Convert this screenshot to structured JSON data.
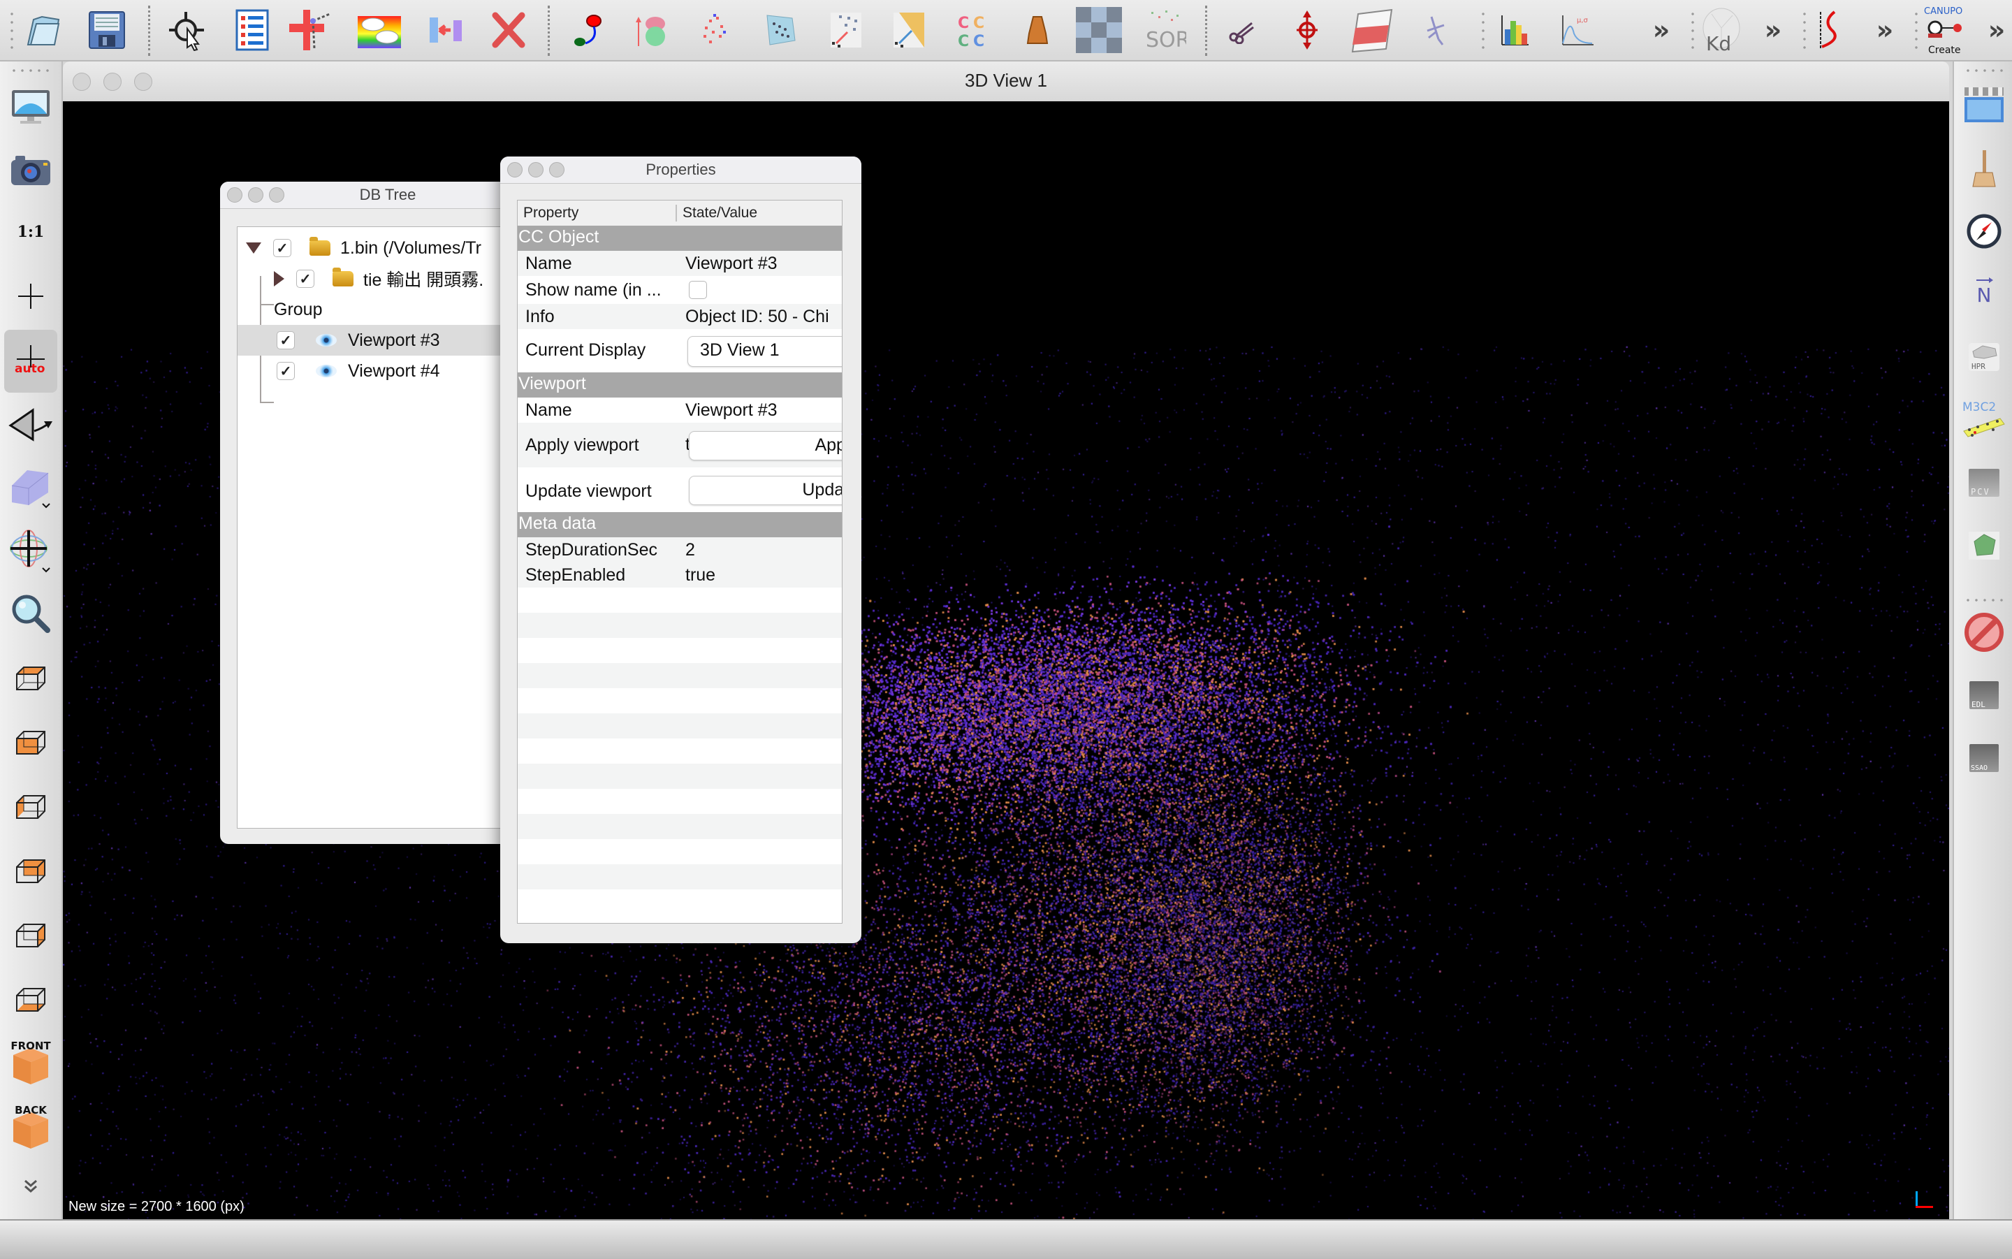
{
  "app": {
    "top_toolbar": {
      "groups": [
        [
          "open-icon",
          "save-icon"
        ],
        [
          "point-picking-icon",
          "properties-list-icon",
          "add-point-icon",
          "scalar-field-rainbow-icon",
          "merge-icon",
          "delete-icon"
        ],
        [
          "segment-icon",
          "normals-icon",
          "sample-points-icon",
          "mesh-icon",
          "registration-icon",
          "fine-registration-icon",
          "compare-cc-icon",
          "volume-icon",
          "checkerboard-icon",
          "sor-filter-icon"
        ],
        [
          "scissors-icon",
          "translate-rotate-icon",
          "cross-section-icon",
          "pick-rotation-center-icon"
        ],
        [
          "histogram-icon",
          "gaussian-fit-icon"
        ],
        [
          "kd-tree-icon"
        ],
        [
          "curve-icon"
        ],
        [
          "canupo-create-icon"
        ]
      ],
      "labels": {
        "sor": "SOR",
        "kd": "Kd",
        "canupo_top": "CANUPO",
        "canupo_bottom": "Create",
        "cc_compare": "CC"
      },
      "overflow_chevron": "»"
    },
    "left_toolbar": {
      "items": [
        {
          "icon": "fullscreen-display-icon"
        },
        {
          "icon": "camera-icon"
        },
        {
          "icon": "zoom-1-1-icon",
          "label": "1:1"
        },
        {
          "icon": "pivot-center-icon"
        },
        {
          "icon": "auto-pivot-icon",
          "label": "auto",
          "active": true
        },
        {
          "icon": "perspective-icon"
        },
        {
          "icon": "orthographic-view-icon"
        },
        {
          "icon": "rotation-lock-icon"
        },
        {
          "icon": "zoom-icon"
        },
        {
          "icon": "view-top-icon"
        },
        {
          "icon": "view-front-icon"
        },
        {
          "icon": "view-left-icon"
        },
        {
          "icon": "view-back-icon"
        },
        {
          "icon": "view-right-icon"
        },
        {
          "icon": "view-bottom-icon"
        },
        {
          "icon": "view-iso-front-icon",
          "label": "FRONT"
        },
        {
          "icon": "view-iso-back-icon",
          "label": "BACK"
        }
      ],
      "overflow": "more-chevron-icon"
    },
    "right_toolbar": {
      "items": [
        {
          "icon": "animation-clapper-icon"
        },
        {
          "icon": "broom-clean-icon"
        },
        {
          "icon": "compass-icon"
        },
        {
          "icon": "north-arrow-icon",
          "label": "N"
        },
        {
          "icon": "hpr-icon",
          "label": "HPR"
        },
        {
          "icon": "m3c2-icon",
          "label": "M3C2"
        },
        {
          "icon": "pcv-icon",
          "label": "PCV"
        },
        {
          "icon": "polygon-icon"
        },
        {
          "icon": "disable-shader-icon"
        },
        {
          "icon": "edl-shader-icon",
          "label": "EDL"
        },
        {
          "icon": "ssao-shader-icon",
          "label": "SSAO"
        }
      ]
    },
    "view_window": {
      "title": "3D View 1",
      "status_message": "New size = 2700 * 1600 (px)"
    },
    "db_tree": {
      "title": "DB Tree",
      "items": [
        {
          "label": "1.bin (/Volumes/Tr",
          "checked": true,
          "expanded": true,
          "icon": "folder-icon",
          "level": 0
        },
        {
          "label": "tie 輸出 開頭霧.",
          "checked": true,
          "expanded": false,
          "icon": "folder-icon",
          "level": 1
        },
        {
          "label": "Group",
          "level": 1
        },
        {
          "label": "Viewport #3",
          "checked": true,
          "icon": "eye-icon",
          "level": 1,
          "selected": true
        },
        {
          "label": "Viewport #4",
          "checked": true,
          "icon": "eye-icon",
          "level": 1
        }
      ]
    },
    "properties": {
      "title": "Properties",
      "columns": [
        "Property",
        "State/Value"
      ],
      "sections": {
        "cc_object": {
          "title": "CC Object",
          "name_label": "Name",
          "name_value": "Viewport #3",
          "show_name_label": "Show name (in ...",
          "show_name_checked": false,
          "info_label": "Info",
          "info_value": "Object ID: 50 - Chi",
          "current_display_label": "Current Display",
          "current_display_value": "3D View 1"
        },
        "viewport": {
          "title": "Viewport",
          "name_label": "Name",
          "name_value": "Viewport #3",
          "apply_label": "Apply viewport",
          "apply_button": "Apply",
          "apply_prefix": "t",
          "update_label": "Update viewport",
          "update_button": "Update"
        },
        "meta_data": {
          "title": "Meta data",
          "rows": [
            {
              "key": "StepDurationSec",
              "value": "2"
            },
            {
              "key": "StepEnabled",
              "value": "true"
            }
          ]
        }
      }
    },
    "colors": {
      "point_cloud_primary": "#5b2fd0",
      "point_cloud_secondary": "#c0507a",
      "point_cloud_accent": "#e08a4a",
      "axis_x": "#ff0000",
      "axis_z": "#00a8ff",
      "section_header": "#a7a7a7"
    }
  }
}
